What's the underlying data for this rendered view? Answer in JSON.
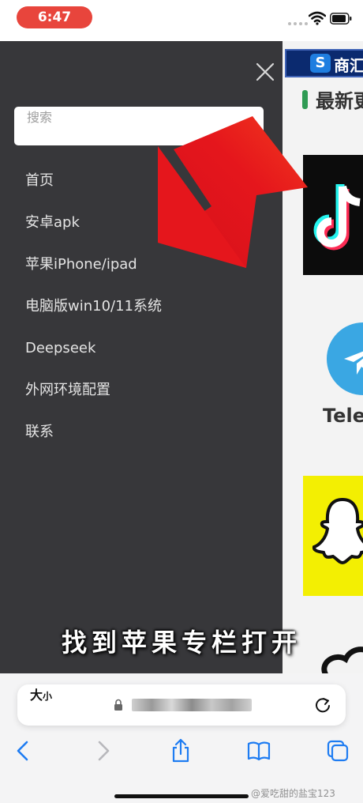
{
  "status_bar": {
    "time": "6:47"
  },
  "website": {
    "logo_s": "S",
    "logo_text": "商汇",
    "section_title": "最新更",
    "telegram_label": "Tele"
  },
  "menu": {
    "search_placeholder": "搜索",
    "items": [
      {
        "label": "首页"
      },
      {
        "label": "安卓apk"
      },
      {
        "label": "苹果iPhone/ipad"
      },
      {
        "label": "电脑版win10/11系统"
      },
      {
        "label": "Deepseek"
      },
      {
        "label": "外网环境配置"
      },
      {
        "label": "联系"
      }
    ]
  },
  "overlay": {
    "caption": "找到苹果专栏打开",
    "arrow_color": "#e5161c"
  },
  "browser": {
    "text_size_big": "大",
    "text_size_small": "小",
    "url": "",
    "watermark": "@爱吃甜的盐宝123"
  },
  "icons": [
    "wifi-icon",
    "battery-icon",
    "close-icon",
    "lock-icon",
    "reload-icon",
    "back-icon",
    "forward-icon",
    "share-icon",
    "bookmarks-icon",
    "tabs-icon"
  ]
}
